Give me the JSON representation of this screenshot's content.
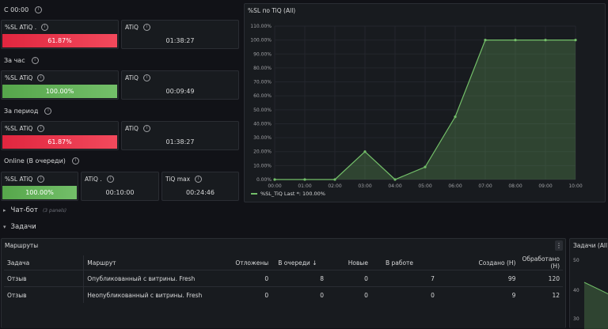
{
  "rows": [
    {
      "title": "C 00:00"
    },
    {
      "title": "За час"
    },
    {
      "title": "За период"
    },
    {
      "title": "Online (В очереди)"
    }
  ],
  "stats": {
    "r1_sl_title": "%SL ATiQ .",
    "r1_sl_value": "61.87%",
    "r1_atiq_title": "ATiQ",
    "r1_atiq_value": "01:38:27",
    "r2_sl_title": "%SL ATiQ",
    "r2_sl_value": "100.00%",
    "r2_atiq_title": "ATiQ",
    "r2_atiq_value": "00:09:49",
    "r3_sl_title": "%SL ATiQ",
    "r3_sl_value": "61.87%",
    "r3_atiq_title": "ATiQ",
    "r3_atiq_value": "01:38:27",
    "r4_sl_title": "%SL ATiQ",
    "r4_sl_value": "100.00%",
    "r4_atiq_title": "ATiQ .",
    "r4_atiq_value": "00:10:00",
    "r4_tiqmax_title": "TiQ max",
    "r4_tiqmax_value": "00:24:46"
  },
  "colors": {
    "red": "#f2495c",
    "green": "#73bf69"
  },
  "sections": {
    "chatbot_title": "Чат-бот",
    "chatbot_count": "(3 panels)",
    "tasks_title": "Задачи"
  },
  "routes_panel": {
    "title": "Маршруты",
    "menu_icon": "vertical-ellipsis-icon",
    "columns": [
      "Задача",
      "Маршрут",
      "Отложены",
      "В очереди",
      "Новые",
      "В работе",
      "Создано (Н)",
      "Обработано (Н)"
    ],
    "sort_icon": "arrow-down-icon",
    "rows": [
      [
        "Отзыв",
        "Опубликованный с витрины. Fresh",
        "0",
        "8",
        "0",
        "7",
        "99",
        "120"
      ],
      [
        "Отзыв",
        "Неопубликованный с витрины. Fresh",
        "0",
        "0",
        "0",
        "0",
        "9",
        "12"
      ]
    ]
  },
  "tasks_panel": {
    "title": "Задачи (All)",
    "ticks": [
      "50",
      "40",
      "30"
    ]
  },
  "chart_data": {
    "type": "area",
    "title": "%SL по TiQ (All)",
    "x": [
      "00:00",
      "01:00",
      "02:00",
      "03:00",
      "04:00",
      "05:00",
      "06:00",
      "07:00",
      "08:00",
      "09:00",
      "10:00"
    ],
    "series": [
      {
        "name": "%SL_TiQ",
        "values": [
          0,
          0,
          0,
          20,
          0,
          9,
          45,
          100,
          100,
          100,
          100
        ]
      }
    ],
    "y_ticks": [
      "0.00%",
      "10.00%",
      "20.00%",
      "30.00%",
      "40.00%",
      "50.00%",
      "60.00%",
      "70.00%",
      "80.00%",
      "90.00%",
      "100.00%",
      "110.00%"
    ],
    "ylim": [
      0,
      110
    ],
    "legend_text": "%SL_TiQ  Last *: 100.00%",
    "legend_placement": "bottom-left",
    "color": "#73bf69"
  }
}
